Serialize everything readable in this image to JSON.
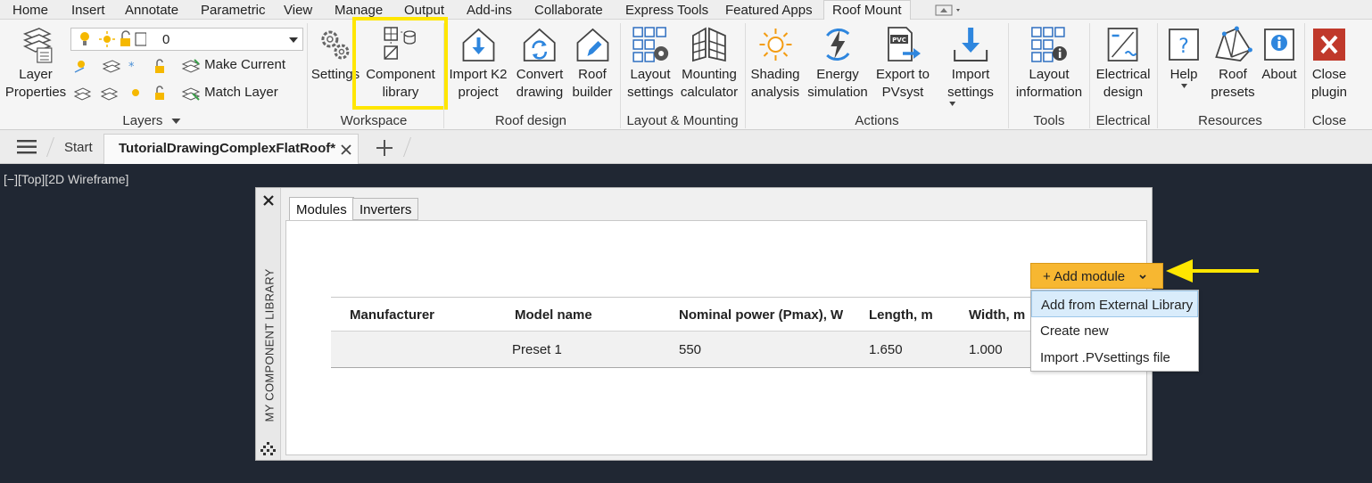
{
  "menu": {
    "items": [
      "Home",
      "Insert",
      "Annotate",
      "Parametric",
      "View",
      "Manage",
      "Output",
      "Add-ins",
      "Collaborate",
      "Express Tools",
      "Featured Apps",
      "Roof Mount"
    ],
    "active": "Roof Mount"
  },
  "ribbon": {
    "layers": {
      "layer_properties": [
        "Layer",
        "Properties"
      ],
      "current_layer": "0",
      "make_current": "Make Current",
      "match_layer": "Match Layer",
      "group_label": "Layers"
    },
    "workspace": {
      "settings": "Settings",
      "component_library": [
        "Component",
        "library"
      ],
      "group_label": "Workspace"
    },
    "roof_design": {
      "import_k2": [
        "Import K2",
        "project"
      ],
      "convert": [
        "Convert",
        "drawing"
      ],
      "roof_builder": [
        "Roof",
        "builder"
      ],
      "group_label": "Roof design"
    },
    "layout_mounting": {
      "layout_settings": [
        "Layout",
        "settings"
      ],
      "mounting_calculator": [
        "Mounting",
        "calculator"
      ],
      "group_label": "Layout & Mounting"
    },
    "actions": {
      "shading": [
        "Shading",
        "analysis"
      ],
      "energy": [
        "Energy",
        "simulation"
      ],
      "export": [
        "Export to",
        "PVsyst"
      ],
      "import": [
        "Import",
        "settings"
      ],
      "group_label": "Actions",
      "pvc_badge": "PVC"
    },
    "tools": {
      "layout_info": [
        "Layout",
        "information"
      ],
      "group_label": "Tools"
    },
    "electrical": {
      "design": [
        "Electrical",
        "design"
      ],
      "group_label": "Electrical"
    },
    "resources": {
      "help": "Help",
      "roof_presets": [
        "Roof",
        "presets"
      ],
      "about": "About",
      "group_label": "Resources"
    },
    "close": {
      "close_plugin": [
        "Close",
        "plugin"
      ],
      "group_label": "Close"
    }
  },
  "file_tabs": {
    "start": "Start",
    "active": "TutorialDrawingComplexFlatRoof*"
  },
  "viewport_label": "[−][Top][2D Wireframe]",
  "palette": {
    "side_title": "MY COMPONENT LIBRARY",
    "tabs": [
      "Modules",
      "Inverters"
    ],
    "add_button": "+ Add module",
    "dropdown": [
      "Add from External Library",
      "Create new",
      "Import .PVsettings file"
    ],
    "columns": [
      "Manufacturer",
      "Model name",
      "Nominal power (Pmax), W",
      "Length, m",
      "Width, m"
    ],
    "rows": [
      {
        "manufacturer": "",
        "model": "Preset 1",
        "power": "550",
        "length": "1.650",
        "width": "1.000"
      }
    ]
  },
  "colors": {
    "highlight_box": "#ffe600",
    "arrow": "#ffe600",
    "add_button": "#f7b731",
    "canvas": "#202733"
  }
}
